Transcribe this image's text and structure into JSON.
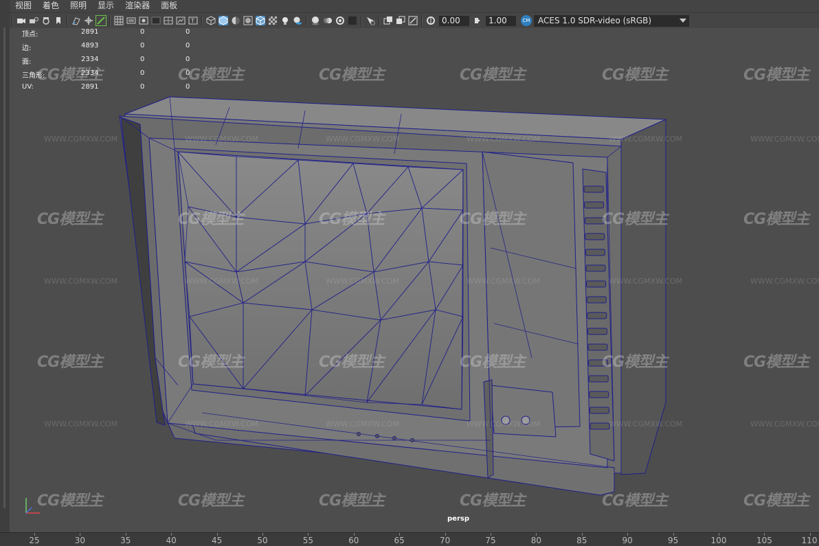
{
  "menu": [
    {
      "label": "视图"
    },
    {
      "label": "着色"
    },
    {
      "label": "照明"
    },
    {
      "label": "显示"
    },
    {
      "label": "渲染器"
    },
    {
      "label": "面板"
    }
  ],
  "toolbar": {
    "exposure_value": "0.00",
    "gamma_value": "1.00",
    "color_space": "ACES 1.0 SDR-video (sRGB)",
    "icons": [
      "camera-icon",
      "camera-lock-icon",
      "camera-attr-icon",
      "bookmark-icon",
      "image-plane-icon",
      "pan-zoom-icon",
      "grease-pencil-icon",
      "grid-icon",
      "film-gate-icon",
      "resolution-gate-icon",
      "gate-mask-icon",
      "field-chart-icon",
      "safe-action-icon",
      "safe-title-icon",
      "wireframe-icon",
      "smooth-shade-icon",
      "default-material-icon",
      "wireframe-on-shaded-icon",
      "textured-icon",
      "xray-icon",
      "lights-icon",
      "shadows-icon",
      "screen-space-ao-icon",
      "motion-blur-icon",
      "multisample-aa-icon",
      "depth-of-field-icon",
      "isolate-select-icon",
      "xray-active-icon",
      "xray-joints-icon",
      "backface-culling-icon",
      "exposure-icon",
      "gamma-icon",
      "color-management-icon"
    ],
    "accent_blue": "#4b8ec4",
    "accent_green": "#6fbf4f"
  },
  "hud": {
    "rows": [
      {
        "label": "顶点:",
        "total": "2891",
        "selected": "0",
        "tri": "0"
      },
      {
        "label": "边:",
        "total": "4893",
        "selected": "0",
        "tri": "0"
      },
      {
        "label": "面:",
        "total": "2334",
        "selected": "0",
        "tri": "0"
      },
      {
        "label": "三角形:",
        "total": "2334",
        "selected": "0",
        "tri": "0"
      },
      {
        "label": "UV:",
        "total": "2891",
        "selected": "0",
        "tri": "0"
      }
    ]
  },
  "viewport": {
    "camera": "persp",
    "wire_color": "#1f1f8a",
    "background": "#4d4d4d"
  },
  "watermark": {
    "logo_text": "CG模型主",
    "url": "WWW.CGMXW.COM"
  },
  "timeline": {
    "labels": [
      "25",
      "30",
      "35",
      "40",
      "45",
      "50",
      "55",
      "60",
      "65",
      "70",
      "75",
      "80",
      "85",
      "90",
      "95",
      "100",
      "105",
      "110"
    ]
  }
}
